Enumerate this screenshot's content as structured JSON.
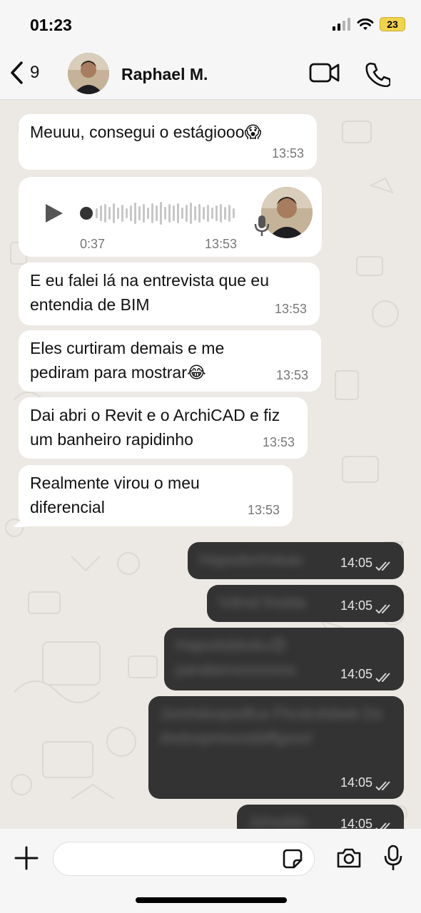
{
  "status_bar": {
    "time": "01:23",
    "battery": "23"
  },
  "header": {
    "back_count": "9",
    "contact_name": "Raphael M."
  },
  "voice_note": {
    "duration": "0:37",
    "time": "13:53"
  },
  "messages": [
    {
      "direction": "incoming",
      "text": "Meuuu, consegui o estágiooo😱",
      "time": "13:53"
    },
    {
      "direction": "incoming",
      "text": "E eu falei lá na entrevista que eu entendia de BIM",
      "time": "13:53"
    },
    {
      "direction": "incoming",
      "text": "Eles curtiram demais e me pediram para mostrar😂",
      "time": "13:53"
    },
    {
      "direction": "incoming",
      "text": "Dai abri o Revit e o ArchiCAD e fiz um banheiro rapidinho",
      "time": "13:53"
    },
    {
      "direction": "incoming",
      "text": "Realmente virou o meu diferencial",
      "time": "13:53"
    },
    {
      "direction": "outgoing",
      "text": "Hapsdsnhskao",
      "time": "14:05"
    },
    {
      "direction": "outgoing",
      "text": "Vdmd fnslda",
      "time": "14:05"
    },
    {
      "direction": "outgoing",
      "text": "Hapsdsbbsku😍 parabenssssssss",
      "time": "14:05"
    },
    {
      "direction": "outgoing",
      "text": "Jsmhdsopsdfca Fhcdcdsbeb Dsdsdsopmisssbbffgsss!",
      "time": "14:05"
    },
    {
      "direction": "outgoing",
      "text": "Jshsddn",
      "time": "14:05"
    }
  ],
  "colors": {
    "incoming_bubble": "#ffffff",
    "outgoing_bubble": "#333333",
    "chat_background": "#ece9e4"
  }
}
